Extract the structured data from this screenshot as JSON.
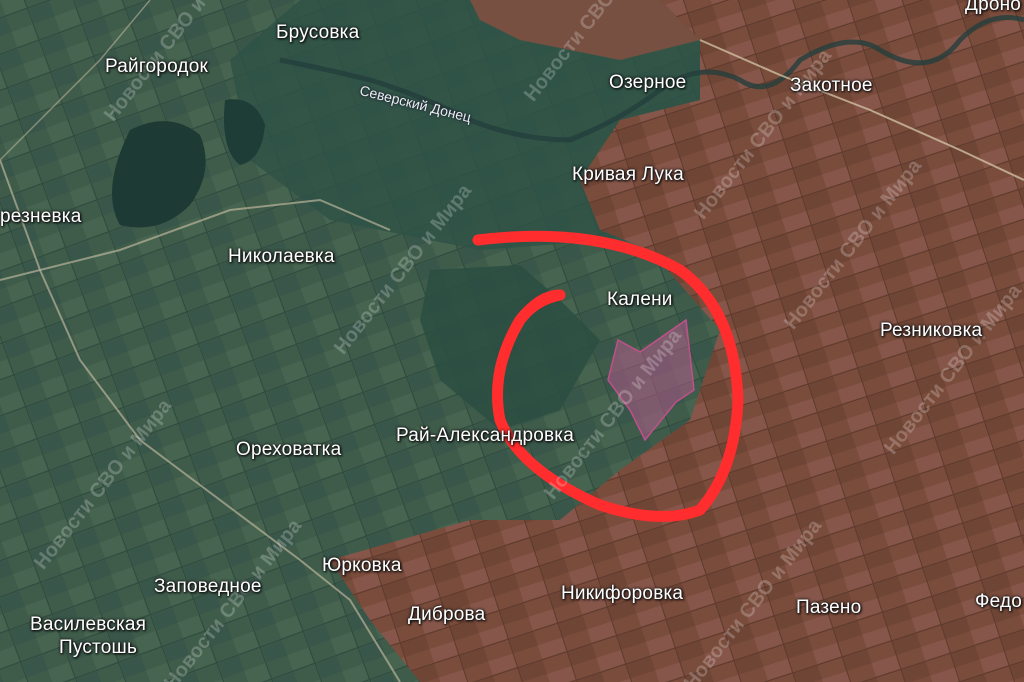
{
  "map": {
    "places": {
      "brusovka": "Брусовка",
      "raygorodok": "Райгородок",
      "ozernoe": "Озерное",
      "zakotnoe": "Закотное",
      "dronovka_partial": "Дроно",
      "krivaya_luka": "Кривая Лука",
      "bereznevka_partial": "резневка",
      "nikolaevka": "Николаевка",
      "kalenik_partial": "Калени",
      "reznikovka": "Резниковка",
      "orekhovatka": "Ореховатка",
      "ray_aleksandrovka": "Рай-Александровка",
      "yurkovka": "Юрковка",
      "zapovednoe": "Заповедное",
      "nikiforovka": "Никифоровка",
      "pazeno": "Пазено",
      "fedorovka_partial": "Федо",
      "vasilevskaya_pustosh_line1": "Василевская",
      "vasilevskaya_pustosh_line2": "Пустошь",
      "dibrova": "Диброва"
    },
    "river": "Северский Донец",
    "watermark": "Новости СВО и Мира",
    "colors": {
      "controlled_territory": "#8a5a48",
      "contested_area": "#b25a8a",
      "highlight_circle": "#ff2d2d"
    }
  }
}
